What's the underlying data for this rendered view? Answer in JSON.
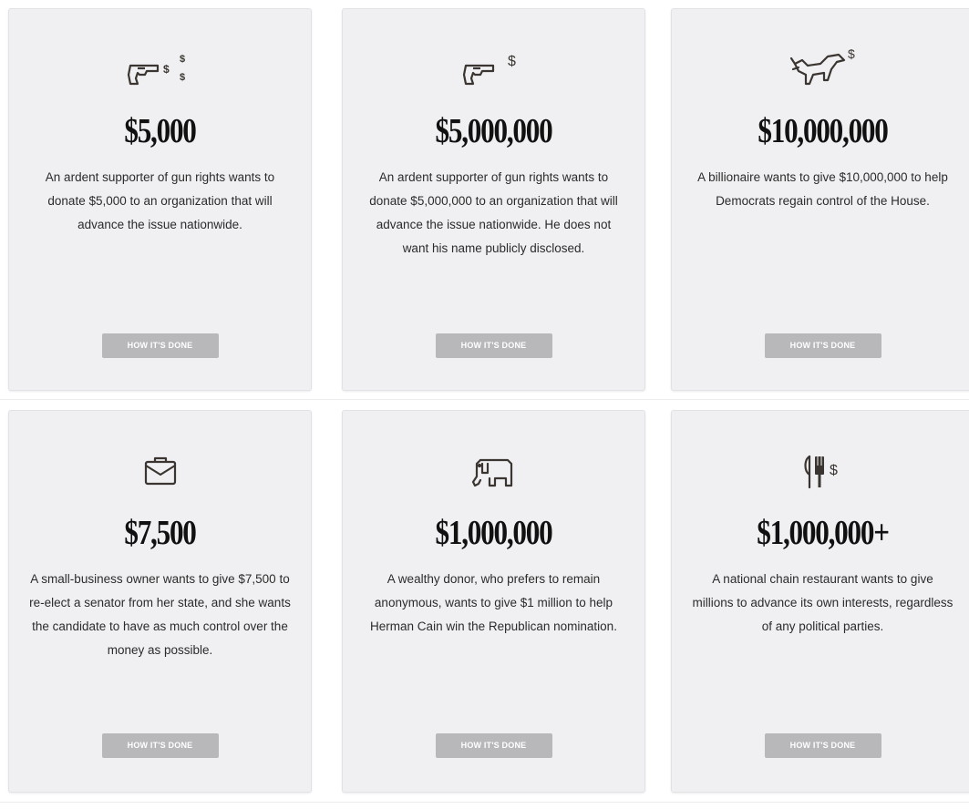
{
  "cards": [
    {
      "icon": "revolver-coins-icon",
      "amount": "$5,000",
      "description": "An ardent supporter of gun rights wants to donate $5,000 to an organization that will advance the issue nationwide.",
      "button_label": "HOW IT'S DONE",
      "icon_text": "$"
    },
    {
      "icon": "revolver-dollar-icon",
      "amount": "$5,000,000",
      "description": "An ardent supporter of gun rights wants to donate $5,000,000 to an organization that will advance the issue nationwide. He does not want his name publicly disclosed.",
      "button_label": "HOW IT'S DONE",
      "icon_text": "$"
    },
    {
      "icon": "donkey-dollar-icon",
      "amount": "$10,000,000",
      "description": "A billionaire wants to give $10,000,000 to help Democrats regain control of the House.",
      "button_label": "HOW IT'S DONE",
      "icon_text": "$"
    },
    {
      "icon": "briefcase-icon",
      "amount": "$7,500",
      "description": "A small-business owner wants to give $7,500 to re-elect a senator from her state, and she wants the candidate to have as much control over the money as possible.",
      "button_label": "HOW IT'S DONE"
    },
    {
      "icon": "elephant-icon",
      "amount": "$1,000,000",
      "description": "A wealthy donor, who prefers to remain anonymous, wants to give $1 million to help Herman Cain win the Republican nomination.",
      "button_label": "HOW IT'S DONE"
    },
    {
      "icon": "knife-fork-dollar-icon",
      "amount": "$1,000,000+",
      "description": "A national chain restaurant wants to give millions to advance its own interests, regardless of any political parties.",
      "button_label": "HOW IT'S DONE",
      "icon_text": "$"
    }
  ],
  "colors": {
    "card_bg": "#f0f0f3",
    "button_bg": "#b8b8bb",
    "text": "#2b2b2b",
    "icon": "#3a3530"
  }
}
